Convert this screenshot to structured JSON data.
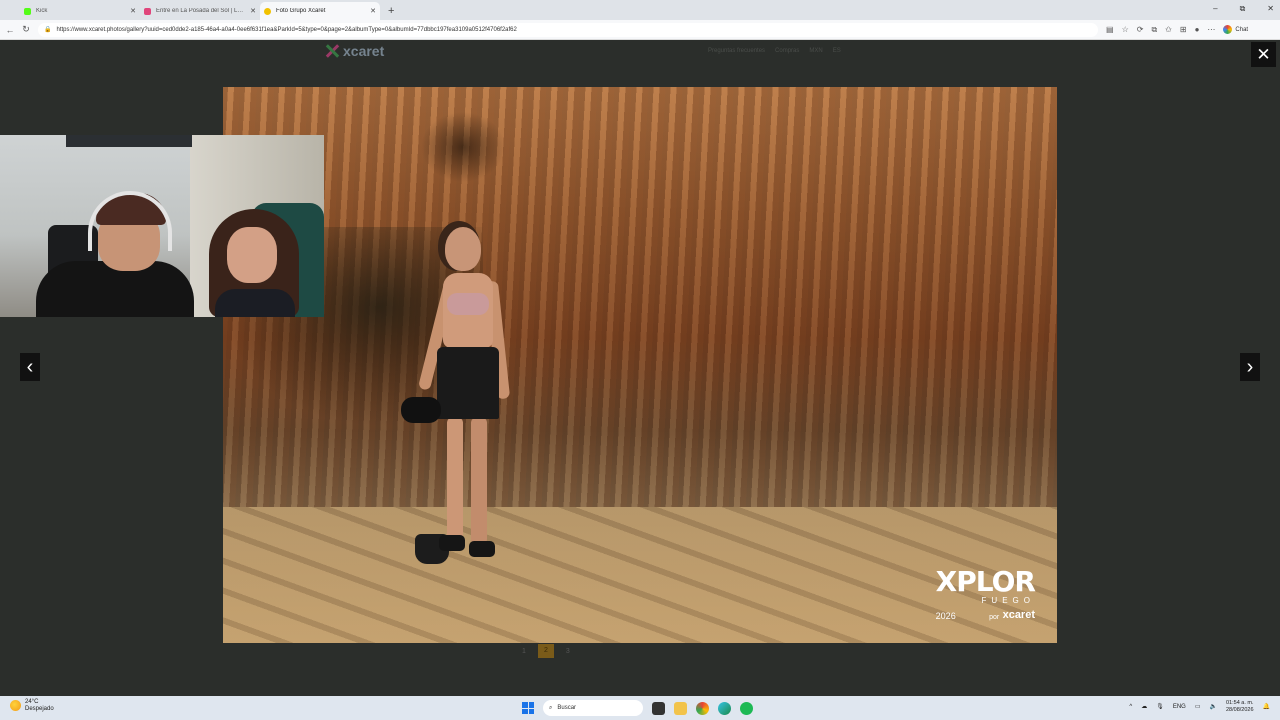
{
  "browser": {
    "tabs": [
      {
        "label": "Kick",
        "favicon_color": "#53fc18"
      },
      {
        "label": "Entre en La Posada del Sol | La pu",
        "favicon_color": "#e0457b"
      },
      {
        "label": "Foto Grupo Xcaret",
        "favicon_color": "#f2c200"
      }
    ],
    "new_tab": "+",
    "url": "https://www.xcaret.photos/gallery?uuid=ced0dde2-a185-46a4-a0a4-0ee6f631f1ea&ParkId=5&type=0&page=2&albumType=0&albumId=77dbbc197fea3109a0512f4706f2af62",
    "chat_label": "Chat",
    "window_controls": [
      "–",
      "⧉",
      "✕"
    ]
  },
  "site": {
    "logo_text": "xcaret",
    "nav": [
      "Preguntas frecuentes",
      "Compras",
      "MXN",
      "ES"
    ]
  },
  "lightbox": {
    "close": "✕",
    "prev": "‹",
    "next": "›",
    "watermark": {
      "brand": "XPLOR",
      "sub": "FUEGO",
      "year": "2026",
      "por": "por",
      "xcaret": "xcaret"
    },
    "pagination": [
      "1",
      "2",
      "3"
    ]
  },
  "taskbar": {
    "weather_temp": "24°C",
    "weather_desc": "Despejado",
    "search_placeholder": "Buscar",
    "lang": "ENG",
    "time": "01:54 a. m.",
    "date": "28/08/2026"
  }
}
